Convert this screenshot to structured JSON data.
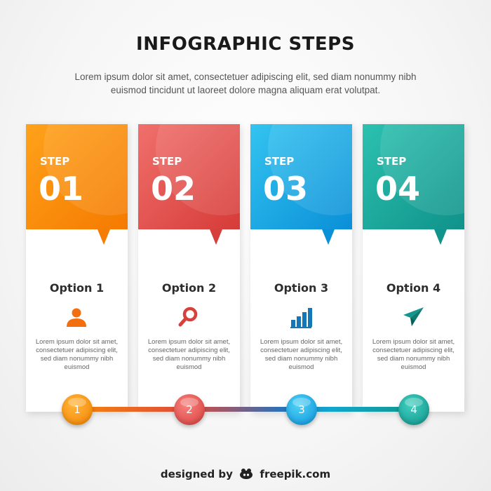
{
  "title": "INFOGRAPHIC STEPS",
  "subtitle": "Lorem ipsum dolor sit amet, consectetuer adipiscing elit, sed diam nonummy nibh euismod tincidunt ut laoreet dolore magna aliquam erat volutpat.",
  "steps": [
    {
      "label": "STEP",
      "number": "01",
      "option": "Option 1",
      "icon": "user-icon",
      "color": "#f57d04",
      "description": "Lorem ipsum dolor sit amet, consectetuer adipiscing elit, sed diam nonummy nibh euismod",
      "dot": "1"
    },
    {
      "label": "STEP",
      "number": "02",
      "option": "Option 2",
      "icon": "search-icon",
      "color": "#d63f3c",
      "description": "Lorem ipsum dolor sit amet, consectetuer adipiscing elit, sed diam nonummy nibh euismod",
      "dot": "2"
    },
    {
      "label": "STEP",
      "number": "03",
      "option": "Option 3",
      "icon": "bar-chart-icon",
      "color": "#0b91d8",
      "description": "Lorem ipsum dolor sit amet, consectetuer adipiscing elit, sed diam nonummy nibh euismod",
      "dot": "3"
    },
    {
      "label": "STEP",
      "number": "04",
      "option": "Option 4",
      "icon": "paper-plane-icon",
      "color": "#10948b",
      "description": "Lorem ipsum dolor sit amet, consectetuer adipiscing elit, sed diam nonummy nibh euismod",
      "dot": "4"
    }
  ],
  "credit": {
    "prefix": "designed by",
    "brand": "freepik.com",
    "logo_icon": "freepik-logo-icon"
  }
}
